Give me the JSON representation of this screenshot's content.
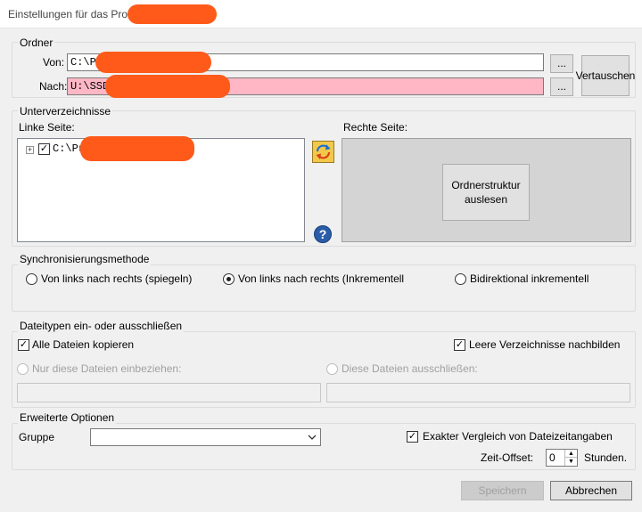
{
  "window": {
    "title": "Einstellungen für das Pro"
  },
  "ordner": {
    "legend": "Ordner",
    "von_label": "Von:",
    "von_value": "C:\\Pr",
    "nach_label": "Nach:",
    "nach_value": "U:\\SSD",
    "browse_label": "...",
    "swap_label": "Vertauschen"
  },
  "unterverzeichnisse": {
    "legend": "Unterverzeichnisse",
    "left_label": "Linke Seite:",
    "right_label": "Rechte Seite:",
    "tree_root": "C:\\Pro",
    "read_button": "Ordnerstruktur auslesen"
  },
  "sync": {
    "legend": "Synchronisierungsmethode",
    "options": [
      {
        "label": "Von links nach rechts (spiegeln)",
        "selected": false
      },
      {
        "label": "Von links nach rechts (Inkrementell",
        "selected": true
      },
      {
        "label": "Bidirektional inkrementell",
        "selected": false
      }
    ]
  },
  "dateitypen": {
    "legend": "Dateitypen ein- oder ausschließen",
    "copy_all": "Alle Dateien kopieren",
    "empty_dirs": "Leere Verzeichnisse nachbilden",
    "include_label": "Nur diese Dateien einbeziehen:",
    "exclude_label": "Diese Dateien ausschließen:"
  },
  "erweitert": {
    "legend": "Erweiterte Optionen",
    "gruppe_label": "Gruppe",
    "gruppe_value": "",
    "exact_compare": "Exakter Vergleich von Dateizeitangaben",
    "offset_label": "Zeit-Offset:",
    "offset_value": "0",
    "offset_unit": "Stunden."
  },
  "footer": {
    "save": "Speichern",
    "cancel": "Abbrechen"
  },
  "colors": {
    "redaction": "#ff5a1a",
    "invalid_field": "#ffb7c5"
  }
}
